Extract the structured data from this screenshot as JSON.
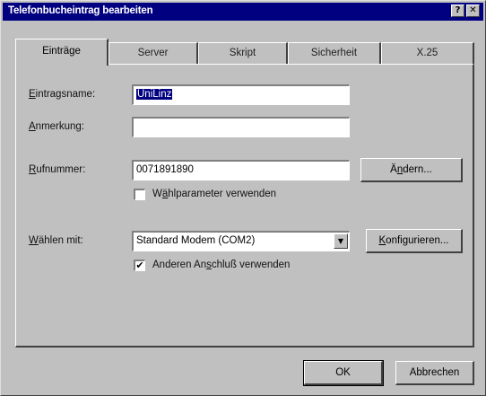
{
  "window": {
    "title": "Telefonbucheintrag bearbeiten",
    "help_glyph": "?",
    "close_glyph": "✕"
  },
  "tabs": [
    {
      "label": "Einträge",
      "active": true
    },
    {
      "label": "Server"
    },
    {
      "label": "Skript"
    },
    {
      "label": "Sicherheit"
    },
    {
      "label": "X.25"
    }
  ],
  "form": {
    "entry_name": {
      "label_first": "E",
      "label_rest": "intragsname:",
      "value": "UniLinz"
    },
    "comment": {
      "label_first": "A",
      "label_rest": "nmerkung:",
      "value": ""
    },
    "phone": {
      "label_first": "R",
      "label_rest": "ufnummer:",
      "value": "0071891890",
      "change_before": "Ä",
      "change_u": "n",
      "change_after": "dern..."
    },
    "dialing_params": {
      "label_before": "W",
      "label_u": "ä",
      "label_after": "hlparameter verwenden",
      "checked": false
    },
    "dial_with": {
      "label_first": "W",
      "label_rest": "ählen mit:",
      "value": "Standard Modem (COM2)",
      "configure_first": "K",
      "configure_rest": "onfigurieren..."
    },
    "other_port": {
      "label_before": "Anderen An",
      "label_u": "s",
      "label_after": "chluß verwenden",
      "checked": true
    }
  },
  "buttons": {
    "ok": "OK",
    "cancel": "Abbrechen"
  },
  "icons": {
    "checkmark": "✔",
    "dropdown_arrow": "▼"
  }
}
